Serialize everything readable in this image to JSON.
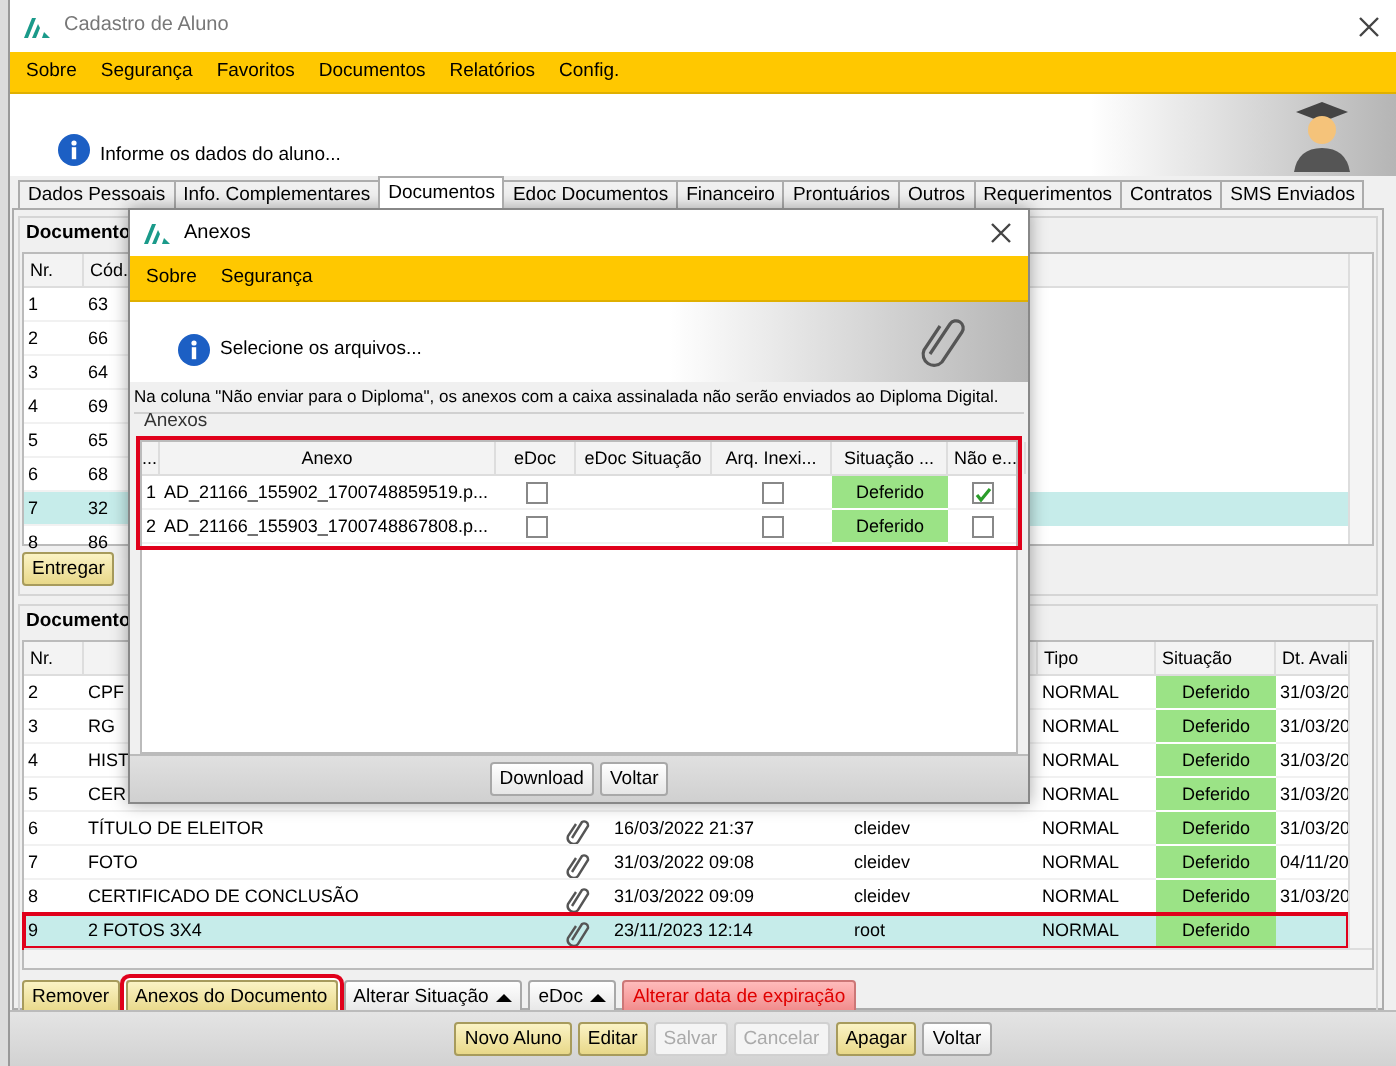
{
  "window": {
    "title": "Cadastro de Aluno"
  },
  "menu": [
    "Sobre",
    "Segurança",
    "Favoritos",
    "Documentos",
    "Relatórios",
    "Config."
  ],
  "header": {
    "message": "Informe os dados do aluno..."
  },
  "tabs": [
    {
      "label": "Dados Pessoais",
      "selected": false
    },
    {
      "label": "Info. Complementares",
      "selected": false
    },
    {
      "label": "Documentos",
      "selected": true
    },
    {
      "label": "Edoc Documentos",
      "selected": false
    },
    {
      "label": "Financeiro",
      "selected": false
    },
    {
      "label": "Prontuários",
      "selected": false
    },
    {
      "label": "Outros",
      "selected": false
    },
    {
      "label": "Requerimentos",
      "selected": false
    },
    {
      "label": "Contratos",
      "selected": false
    },
    {
      "label": "SMS Enviados",
      "selected": false
    }
  ],
  "required_documents": {
    "title": "Documento",
    "columns": [
      "Nr.",
      "Cód."
    ],
    "rows": [
      {
        "cells": [
          "1",
          "63"
        ],
        "selected": false
      },
      {
        "cells": [
          "2",
          "66"
        ],
        "selected": false
      },
      {
        "cells": [
          "3",
          "64"
        ],
        "selected": false
      },
      {
        "cells": [
          "4",
          "69"
        ],
        "selected": false
      },
      {
        "cells": [
          "5",
          "65"
        ],
        "selected": false
      },
      {
        "cells": [
          "6",
          "68"
        ],
        "selected": false
      },
      {
        "cells": [
          "7",
          "32"
        ],
        "selected": true
      },
      {
        "cells": [
          "8",
          "86"
        ],
        "selected": false
      }
    ],
    "buttons": [
      {
        "label": "Entregar",
        "kind": "primary"
      }
    ]
  },
  "delivered_documents": {
    "title": "Documento",
    "columns": {
      "nr": "Nr.",
      "type": "Tipo",
      "status": "Situação",
      "column_8": "Dt. Avali"
    },
    "rows": [
      {
        "nr": "2",
        "name": "CPF",
        "type": "NORMAL",
        "status": "Deferido",
        "column_8": "31/03/20",
        "selected": false,
        "highlighted": false
      },
      {
        "nr": "3",
        "name": "RG",
        "type": "NORMAL",
        "status": "Deferido",
        "column_8": "31/03/20",
        "selected": false,
        "highlighted": false
      },
      {
        "nr": "4",
        "name": "HIST",
        "type": "NORMAL",
        "status": "Deferido",
        "column_8": "31/03/20",
        "selected": false,
        "highlighted": false
      },
      {
        "nr": "5",
        "name": "CER",
        "type": "NORMAL",
        "status": "Deferido",
        "column_8": "31/03/20",
        "selected": false,
        "highlighted": false
      },
      {
        "nr": "6",
        "name": "TÍTULO DE ELEITOR",
        "attached": true,
        "date": "16/03/2022 21:37",
        "user": "cleidev",
        "type": "NORMAL",
        "status": "Deferido",
        "column_8": "31/03/20",
        "selected": false,
        "highlighted": false
      },
      {
        "nr": "7",
        "name": "FOTO",
        "attached": true,
        "date": "31/03/2022 09:08",
        "user": "cleidev",
        "type": "NORMAL",
        "status": "Deferido",
        "column_8": "04/11/20",
        "selected": false,
        "highlighted": false
      },
      {
        "nr": "8",
        "name": "CERTIFICADO DE CONCLUSÃO",
        "attached": true,
        "date": "31/03/2022 09:09",
        "user": "cleidev",
        "type": "NORMAL",
        "status": "Deferido",
        "column_8": "31/03/20",
        "selected": false,
        "highlighted": false
      },
      {
        "nr": "9",
        "name": "2 FOTOS 3X4",
        "attached": true,
        "date": "23/11/2023 12:14",
        "user": "root",
        "type": "NORMAL",
        "status": "Deferido",
        "selected": true,
        "highlighted": true
      }
    ],
    "buttons": [
      {
        "label": "Remover",
        "kind": "primary",
        "highlighted": false
      },
      {
        "label": "Anexos do Documento",
        "kind": "primary",
        "highlighted": true
      },
      {
        "label": "Alterar Situação",
        "kind": "default",
        "dropdown": true,
        "highlighted": false
      },
      {
        "label": "eDoc",
        "kind": "default",
        "dropdown": true,
        "highlighted": false
      },
      {
        "label": "Alterar data de expiração",
        "kind": "danger",
        "highlighted": false
      }
    ]
  },
  "footer_buttons": [
    {
      "label": "Novo Aluno",
      "kind": "primary",
      "disabled": false
    },
    {
      "label": "Editar",
      "kind": "primary",
      "disabled": false
    },
    {
      "label": "Salvar",
      "kind": "default",
      "disabled": true
    },
    {
      "label": "Cancelar",
      "kind": "default",
      "disabled": true
    },
    {
      "label": "Apagar",
      "kind": "primary",
      "disabled": false
    },
    {
      "label": "Voltar",
      "kind": "default",
      "disabled": false
    }
  ],
  "dialog": {
    "title": "Anexos",
    "menu": [
      "Sobre",
      "Segurança"
    ],
    "message": "Selecione os arquivos...",
    "note": "Na coluna \"Não enviar para o Diploma\", os anexos com a caixa assinalada não serão enviados ao Diploma Digital.",
    "group_title": "Anexos",
    "table_highlighted": true,
    "columns": [
      "...",
      "Anexo",
      "eDoc",
      "eDoc Situação",
      "Arq. Inexi...",
      "Situação ...",
      "Não e..."
    ],
    "rows": [
      {
        "nr": "1",
        "file": "AD_21166_155902_1700748859519.p...",
        "edoc": false,
        "missing_file": false,
        "status": "Deferido",
        "do_not_send": true
      },
      {
        "nr": "2",
        "file": "AD_21166_155903_1700748867808.p...",
        "edoc": false,
        "missing_file": false,
        "status": "Deferido",
        "do_not_send": false
      }
    ],
    "buttons": [
      {
        "label": "Download",
        "kind": "default"
      },
      {
        "label": "Voltar",
        "kind": "default"
      }
    ]
  }
}
